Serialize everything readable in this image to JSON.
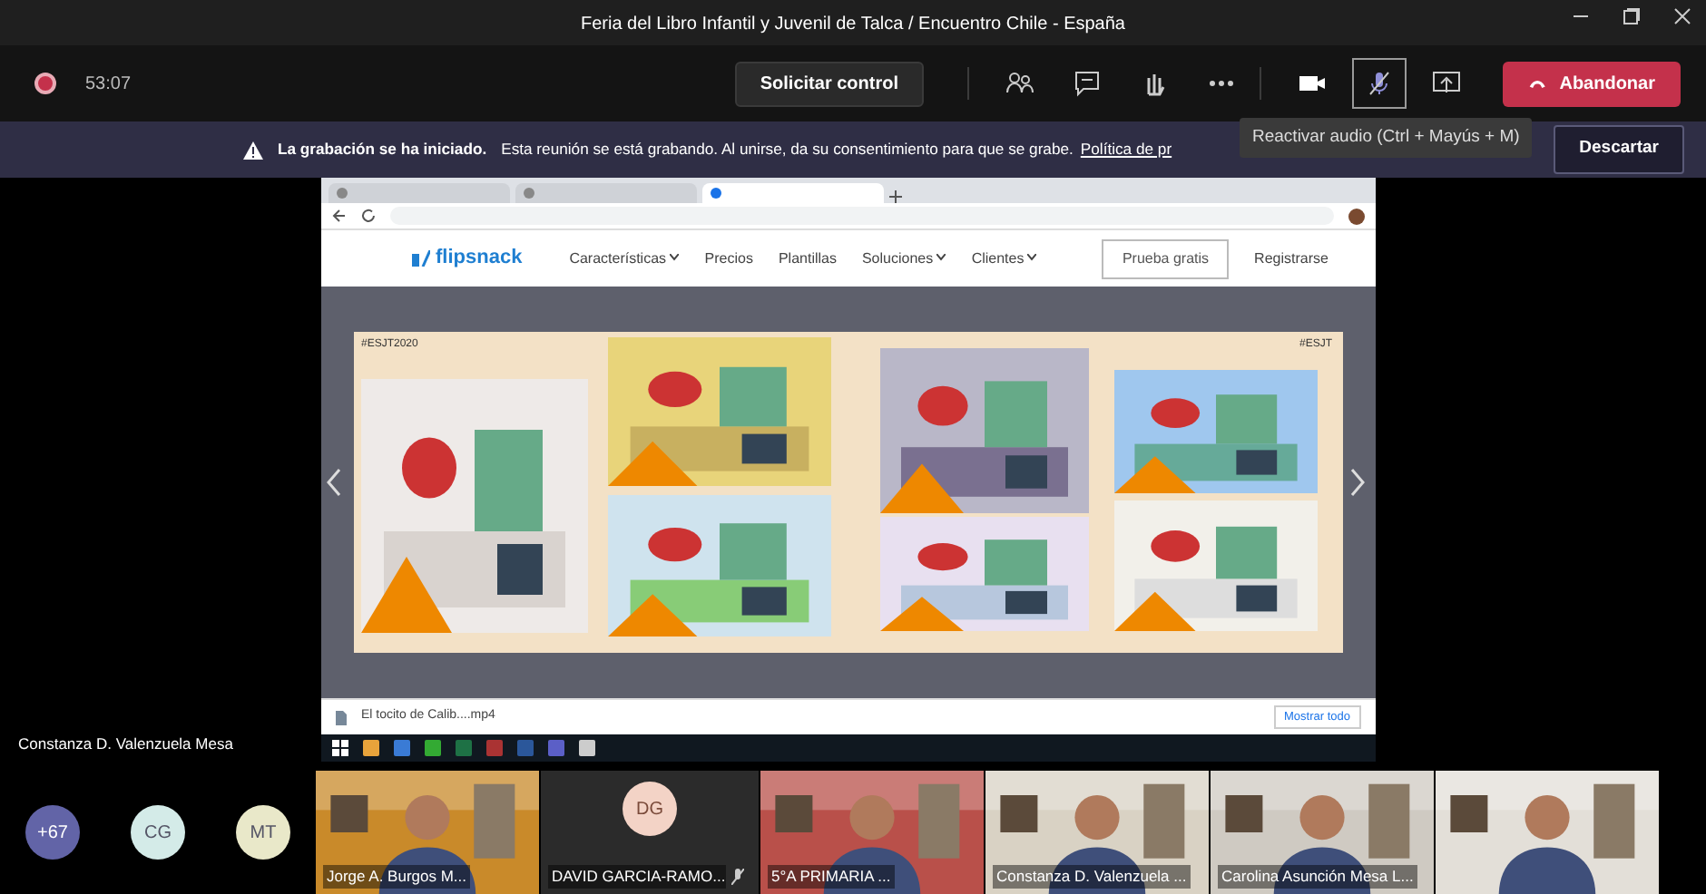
{
  "window": {
    "title": "Feria del Libro Infantil y Juvenil de Talca / Encuentro Chile - España"
  },
  "meeting_bar": {
    "recording": true,
    "timer": "53:07",
    "request_control": "Solicitar control",
    "mic_selected": true,
    "leave": "Abandonar",
    "tooltip": "Reactivar audio (Ctrl + Mayús + M)"
  },
  "recording_notice": {
    "title": "La grabación se ha iniciado.",
    "text": "Esta reunión se está grabando. Al unirse, da su consentimiento para que se grabe.",
    "link": "Política de pr",
    "dismiss": "Descartar"
  },
  "shared_screen": {
    "browser_tabs": [
      {
        "selected": false
      },
      {
        "selected": false
      },
      {
        "selected": true
      }
    ],
    "site": {
      "logo": "flipsnack",
      "nav": [
        {
          "label": "Características",
          "dropdown": true
        },
        {
          "label": "Precios",
          "dropdown": false
        },
        {
          "label": "Plantillas",
          "dropdown": false
        },
        {
          "label": "Soluciones",
          "dropdown": true
        },
        {
          "label": "Clientes",
          "dropdown": true
        }
      ],
      "trial": "Prueba gratis",
      "register": "Registrarse"
    },
    "book": {
      "left_tag": "#ESJT2020",
      "right_tag": "#ESJT"
    },
    "download": {
      "file": "El tocito de Calib....mp4",
      "show_all": "Mostrar todo"
    }
  },
  "presenter_name": "Constanza D. Valenzuela Mesa",
  "participants": [
    {
      "kind": "avatar",
      "initials": "+67",
      "color": "#6264a7"
    },
    {
      "kind": "avatar",
      "initials": "CG",
      "color": "#d4ebe8"
    },
    {
      "kind": "avatar",
      "initials": "MT",
      "color": "#e9e8c9"
    },
    {
      "kind": "video",
      "name": "Jorge A. Burgos M..."
    },
    {
      "kind": "tile",
      "initials": "DG",
      "name": "DAVID GARCIA-RAMO...",
      "color": "#f3d3c6"
    },
    {
      "kind": "video",
      "name": "5°A PRIMARIA ..."
    },
    {
      "kind": "video",
      "name": "Constanza D. Valenzuela ..."
    },
    {
      "kind": "video",
      "name": "Carolina Asunción Mesa L..."
    },
    {
      "kind": "video"
    }
  ]
}
